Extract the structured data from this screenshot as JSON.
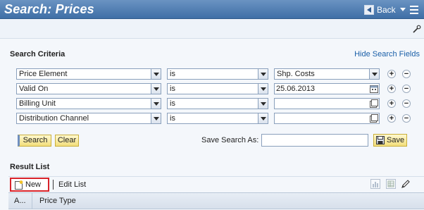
{
  "header": {
    "title": "Search: Prices",
    "back_label": "Back"
  },
  "search_criteria": {
    "title": "Search Criteria",
    "hide_link": "Hide Search Fields",
    "rows": [
      {
        "field": "Price Element",
        "operator": "is",
        "value": "Shp. Costs",
        "value_kind": "select"
      },
      {
        "field": "Valid On",
        "operator": "is",
        "value": "25.06.2013",
        "value_kind": "date"
      },
      {
        "field": "Billing Unit",
        "operator": "is",
        "value": "",
        "value_kind": "input"
      },
      {
        "field": "Distribution Channel",
        "operator": "is",
        "value": "",
        "value_kind": "input"
      }
    ],
    "add_symbol": "+",
    "remove_symbol": "−",
    "search_label": "Search",
    "clear_label": "Clear",
    "save_search_label": "Save Search As:",
    "save_search_value": "",
    "save_label": "Save"
  },
  "result_list": {
    "title": "Result List",
    "new_label": "New",
    "edit_list_label": "Edit List",
    "columns": [
      "A...",
      "Price Type"
    ]
  },
  "colors": {
    "header": "#3f6fa6",
    "accent_link": "#1a5fa8",
    "button": "#f2de7b",
    "highlight": "#d9232a"
  }
}
